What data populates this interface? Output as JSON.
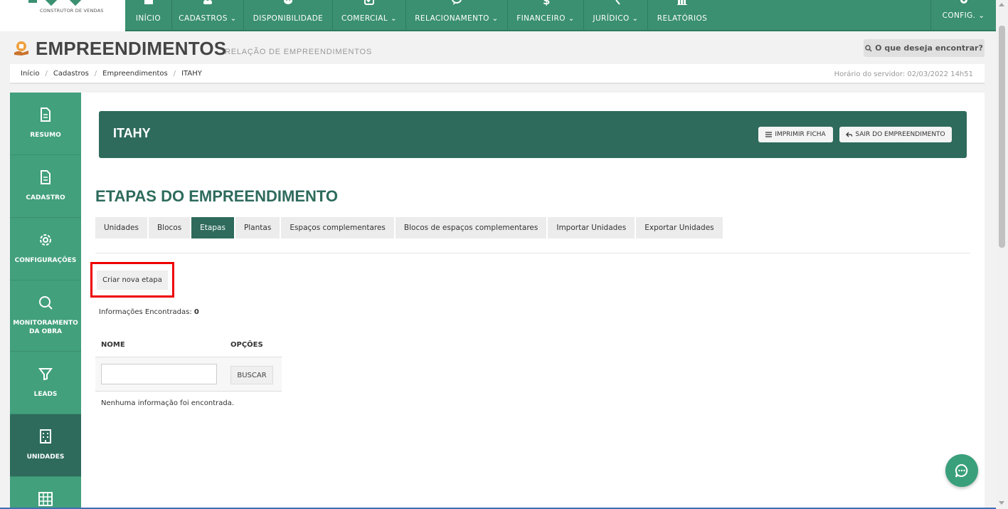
{
  "logo": {
    "subtitle": "CONSTRUTOR DE VENDAS"
  },
  "nav": {
    "items": [
      {
        "label": "INÍCIO",
        "icon": "home-icon"
      },
      {
        "label": "CADASTROS ⌄",
        "icon": "users-icon"
      },
      {
        "label": "DISPONIBILIDADE",
        "icon": "palette-icon"
      },
      {
        "label": "COMERCIAL ⌄",
        "icon": "check-square-icon"
      },
      {
        "label": "RELACIONAMENTO ⌄",
        "icon": "chat-icon"
      },
      {
        "label": "FINANCEIRO ⌄",
        "icon": "dollar-icon"
      },
      {
        "label": "JURÍDICO ⌄",
        "icon": "gavel-icon"
      },
      {
        "label": "RELATÓRIOS",
        "icon": "bar-chart-icon"
      }
    ],
    "config": "CONFIG. ⌄"
  },
  "header": {
    "title": "EMPREENDIMENTOS",
    "subtitle": "RELAÇÃO DE EMPREENDIMENTOS",
    "search_label": "O que deseja encontrar?"
  },
  "breadcrumb": {
    "items": [
      "Início",
      "Cadastros",
      "Empreendimentos",
      "ITAHY"
    ],
    "server_time": "Horário do servidor: 02/03/2022 14h51"
  },
  "sidebar": {
    "items": [
      {
        "label": "RESUMO",
        "icon": "document-icon"
      },
      {
        "label": "CADASTRO",
        "icon": "document-icon"
      },
      {
        "label": "CONFIGURAÇÕES",
        "icon": "gear-icon"
      },
      {
        "label": "MONITORAMENTO DA OBRA",
        "icon": "search-icon"
      },
      {
        "label": "LEADS",
        "icon": "funnel-icon"
      },
      {
        "label": "UNIDADES",
        "icon": "building-icon"
      },
      {
        "label": "",
        "icon": "grid-icon"
      }
    ],
    "active": "UNIDADES"
  },
  "project": {
    "name": "ITAHY",
    "print_label": "IMPRIMIR FICHA",
    "exit_label": "SAIR DO EMPREENDIMENTO"
  },
  "section": {
    "title": "ETAPAS DO EMPREENDIMENTO",
    "tabs": [
      "Unidades",
      "Blocos",
      "Etapas",
      "Plantas",
      "Espaços complementares",
      "Blocos de espaços complementares",
      "Importar Unidades",
      "Exportar Unidades"
    ],
    "active_tab": "Etapas",
    "create_label": "Criar nova etapa",
    "found_label": "Informações Encontradas:",
    "found_count": "0"
  },
  "table": {
    "col_name": "NOME",
    "col_options": "OPÇÕES",
    "name_value": "",
    "search_button": "BUSCAR",
    "empty_message": "Nenhuma informação foi encontrada."
  },
  "colors": {
    "primary": "#3a9070",
    "dark": "#2e6b5c",
    "sidebar": "#42a07c",
    "highlight": "#ee0000"
  }
}
